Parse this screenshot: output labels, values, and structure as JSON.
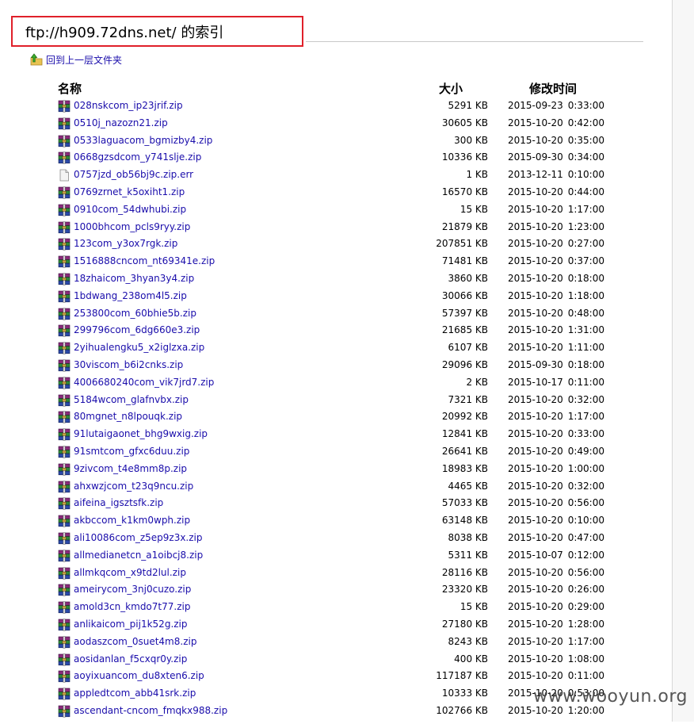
{
  "title": "ftp://h909.72dns.net/ 的索引",
  "parent_link": "回到上一层文件夹",
  "columns": {
    "name": "名称",
    "size": "大小",
    "modified": "修改时间"
  },
  "icons": {
    "parent": "folder-up-arrow-icon",
    "archive": "winrar-archive-icon",
    "file": "blank-document-icon"
  },
  "colors": {
    "link": "#1a0dab",
    "highlight_box": "#e0202a"
  },
  "files": [
    {
      "name": "028nskcom_ip23jrif.zip",
      "size": "5291 KB",
      "date": "2015-09-23",
      "time": "0:33:00",
      "icon": "archive"
    },
    {
      "name": "0510j_nazozn21.zip",
      "size": "30605 KB",
      "date": "2015-10-20",
      "time": "0:42:00",
      "icon": "archive"
    },
    {
      "name": "0533laguacom_bgmizby4.zip",
      "size": "300 KB",
      "date": "2015-10-20",
      "time": "0:35:00",
      "icon": "archive"
    },
    {
      "name": "0668gzsdcom_y741slje.zip",
      "size": "10336 KB",
      "date": "2015-09-30",
      "time": "0:34:00",
      "icon": "archive"
    },
    {
      "name": "0757jzd_ob56bj9c.zip.err",
      "size": "1 KB",
      "date": "2013-12-11",
      "time": "0:10:00",
      "icon": "file"
    },
    {
      "name": "0769zrnet_k5oxiht1.zip",
      "size": "16570 KB",
      "date": "2015-10-20",
      "time": "0:44:00",
      "icon": "archive"
    },
    {
      "name": "0910com_54dwhubi.zip",
      "size": "15 KB",
      "date": "2015-10-20",
      "time": "1:17:00",
      "icon": "archive"
    },
    {
      "name": "1000bhcom_pcls9ryy.zip",
      "size": "21879 KB",
      "date": "2015-10-20",
      "time": "1:23:00",
      "icon": "archive"
    },
    {
      "name": "123com_y3ox7rgk.zip",
      "size": "207851 KB",
      "date": "2015-10-20",
      "time": "0:27:00",
      "icon": "archive"
    },
    {
      "name": "1516888cncom_nt69341e.zip",
      "size": "71481 KB",
      "date": "2015-10-20",
      "time": "0:37:00",
      "icon": "archive"
    },
    {
      "name": "18zhaicom_3hyan3y4.zip",
      "size": "3860 KB",
      "date": "2015-10-20",
      "time": "0:18:00",
      "icon": "archive"
    },
    {
      "name": "1bdwang_238om4l5.zip",
      "size": "30066 KB",
      "date": "2015-10-20",
      "time": "1:18:00",
      "icon": "archive"
    },
    {
      "name": "253800com_60bhie5b.zip",
      "size": "57397 KB",
      "date": "2015-10-20",
      "time": "0:48:00",
      "icon": "archive"
    },
    {
      "name": "299796com_6dg660e3.zip",
      "size": "21685 KB",
      "date": "2015-10-20",
      "time": "1:31:00",
      "icon": "archive"
    },
    {
      "name": "2yihualengku5_x2iglzxa.zip",
      "size": "6107 KB",
      "date": "2015-10-20",
      "time": "1:11:00",
      "icon": "archive"
    },
    {
      "name": "30viscom_b6i2cnks.zip",
      "size": "29096 KB",
      "date": "2015-09-30",
      "time": "0:18:00",
      "icon": "archive"
    },
    {
      "name": "4006680240com_vik7jrd7.zip",
      "size": "2 KB",
      "date": "2015-10-17",
      "time": "0:11:00",
      "icon": "archive"
    },
    {
      "name": "5184wcom_glafnvbx.zip",
      "size": "7321 KB",
      "date": "2015-10-20",
      "time": "0:32:00",
      "icon": "archive"
    },
    {
      "name": "80mgnet_n8lpouqk.zip",
      "size": "20992 KB",
      "date": "2015-10-20",
      "time": "1:17:00",
      "icon": "archive"
    },
    {
      "name": "91lutaigaonet_bhg9wxig.zip",
      "size": "12841 KB",
      "date": "2015-10-20",
      "time": "0:33:00",
      "icon": "archive"
    },
    {
      "name": "91smtcom_gfxc6duu.zip",
      "size": "26641 KB",
      "date": "2015-10-20",
      "time": "0:49:00",
      "icon": "archive"
    },
    {
      "name": "9zivcom_t4e8mm8p.zip",
      "size": "18983 KB",
      "date": "2015-10-20",
      "time": "1:00:00",
      "icon": "archive"
    },
    {
      "name": "ahxwzjcom_t23q9ncu.zip",
      "size": "4465 KB",
      "date": "2015-10-20",
      "time": "0:32:00",
      "icon": "archive"
    },
    {
      "name": "aifeina_igsztsfk.zip",
      "size": "57033 KB",
      "date": "2015-10-20",
      "time": "0:56:00",
      "icon": "archive"
    },
    {
      "name": "akbccom_k1km0wph.zip",
      "size": "63148 KB",
      "date": "2015-10-20",
      "time": "0:10:00",
      "icon": "archive"
    },
    {
      "name": "ali10086com_z5ep9z3x.zip",
      "size": "8038 KB",
      "date": "2015-10-20",
      "time": "0:47:00",
      "icon": "archive"
    },
    {
      "name": "allmedianetcn_a1oibcj8.zip",
      "size": "5311 KB",
      "date": "2015-10-07",
      "time": "0:12:00",
      "icon": "archive"
    },
    {
      "name": "allmkqcom_x9td2lul.zip",
      "size": "28116 KB",
      "date": "2015-10-20",
      "time": "0:56:00",
      "icon": "archive"
    },
    {
      "name": "ameirycom_3nj0cuzo.zip",
      "size": "23320 KB",
      "date": "2015-10-20",
      "time": "0:26:00",
      "icon": "archive"
    },
    {
      "name": "amold3cn_kmdo7t77.zip",
      "size": "15 KB",
      "date": "2015-10-20",
      "time": "0:29:00",
      "icon": "archive"
    },
    {
      "name": "anlikaicom_pij1k52g.zip",
      "size": "27180 KB",
      "date": "2015-10-20",
      "time": "1:28:00",
      "icon": "archive"
    },
    {
      "name": "aodaszcom_0suet4m8.zip",
      "size": "8243 KB",
      "date": "2015-10-20",
      "time": "1:17:00",
      "icon": "archive"
    },
    {
      "name": "aosidanlan_f5cxqr0y.zip",
      "size": "400 KB",
      "date": "2015-10-20",
      "time": "1:08:00",
      "icon": "archive"
    },
    {
      "name": "aoyixuancom_du8xten6.zip",
      "size": "117187 KB",
      "date": "2015-10-20",
      "time": "0:11:00",
      "icon": "archive"
    },
    {
      "name": "appledtcom_abb41srk.zip",
      "size": "10333 KB",
      "date": "2015-10-20",
      "time": "0:53:00",
      "icon": "archive"
    },
    {
      "name": "ascendant-cncom_fmqkx988.zip",
      "size": "102766 KB",
      "date": "2015-10-20",
      "time": "1:20:00",
      "icon": "archive"
    }
  ],
  "watermark": "www.wooyun.org"
}
